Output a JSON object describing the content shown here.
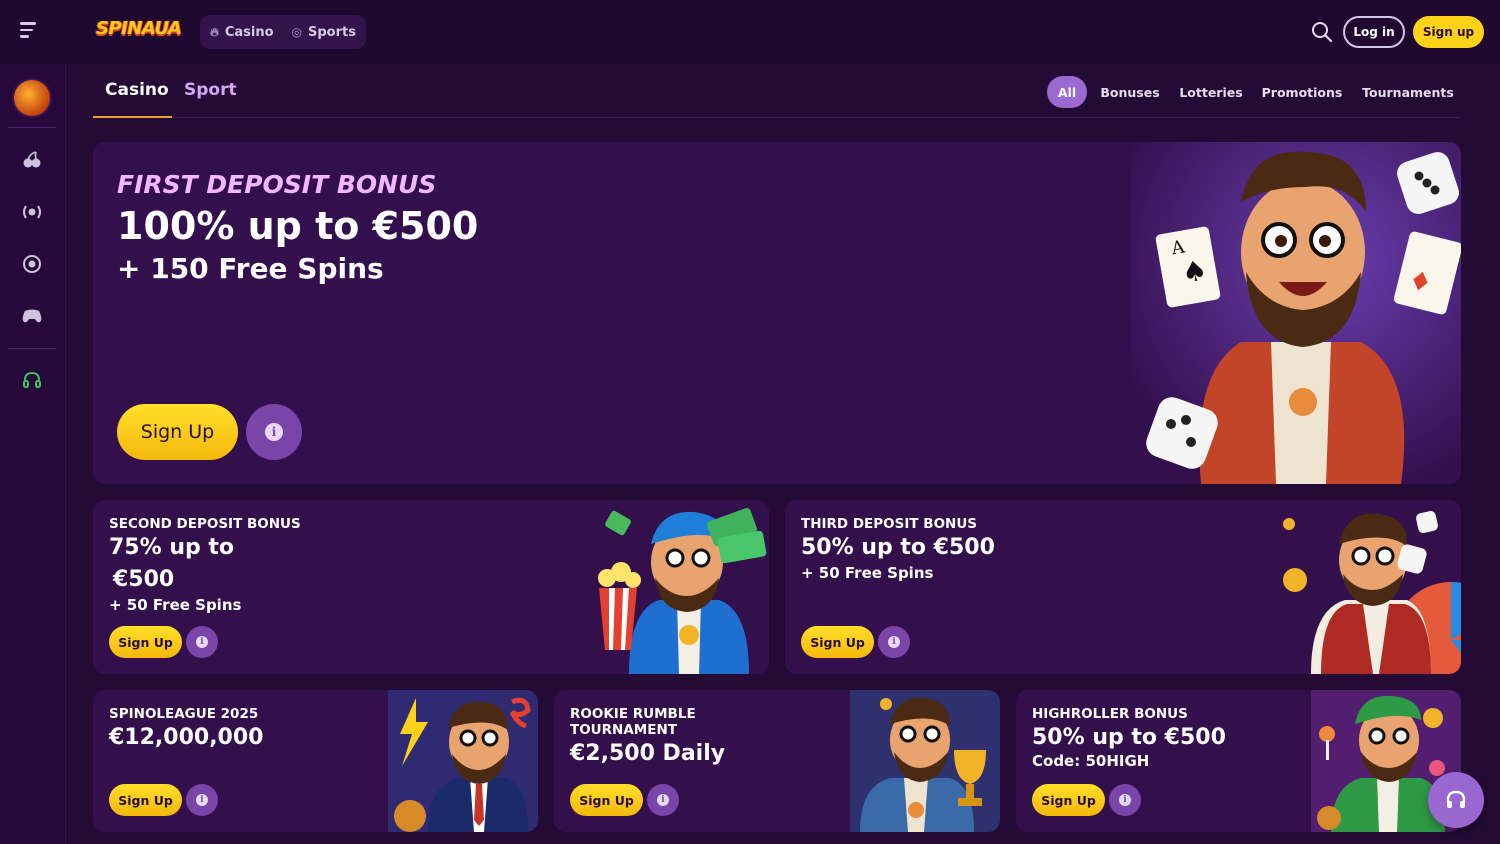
{
  "brand": {
    "logo_text": "SPINAUA",
    "accent": "#ffd21a",
    "brand_purple": "#9b6ad0"
  },
  "header": {
    "tabs": [
      {
        "label": "Casino",
        "icon": "fire-icon"
      },
      {
        "label": "Sports",
        "icon": "ball-icon"
      }
    ],
    "login_label": "Log in",
    "signup_label": "Sign up"
  },
  "sidebar": {
    "items": [
      {
        "icon": "cherries-icon"
      },
      {
        "icon": "live-broadcast-icon"
      },
      {
        "icon": "sports-ball-icon"
      },
      {
        "icon": "gamepad-icon"
      },
      {
        "icon": "headset-icon"
      }
    ]
  },
  "categories": {
    "tabs": [
      "Casino",
      "Sport"
    ],
    "active": "Casino"
  },
  "filters": {
    "items": [
      "All",
      "Bonuses",
      "Lotteries",
      "Promotions",
      "Tournaments"
    ],
    "active": "All"
  },
  "hero": {
    "title": "FIRST DEPOSIT BONUS",
    "line1": "100% up to €500",
    "line2": "+ 150 Free Spins",
    "signup_label": "Sign Up"
  },
  "cards": [
    {
      "subtitle": "SECOND DEPOSIT BONUS",
      "main1": "75% up to",
      "main2": "€500",
      "extra": "+ 50 Free Spins",
      "signup_label": "Sign Up"
    },
    {
      "subtitle": "THIRD DEPOSIT BONUS",
      "main1": "50% up to €500",
      "extra": "+ 50 Free Spins",
      "signup_label": "Sign Up"
    },
    {
      "subtitle": "SPINOLEAGUE 2025",
      "main1": "€12,000,000",
      "signup_label": "Sign Up"
    },
    {
      "subtitle_line1": "ROOKIE RUMBLE",
      "subtitle_line2": "TOURNAMENT",
      "main1": "€2,500 Daily",
      "signup_label": "Sign Up"
    },
    {
      "subtitle": "HIGHROLLER BONUS",
      "main1": "50% up to €500",
      "extra": "Code: 50HIGH",
      "signup_label": "Sign Up"
    }
  ]
}
